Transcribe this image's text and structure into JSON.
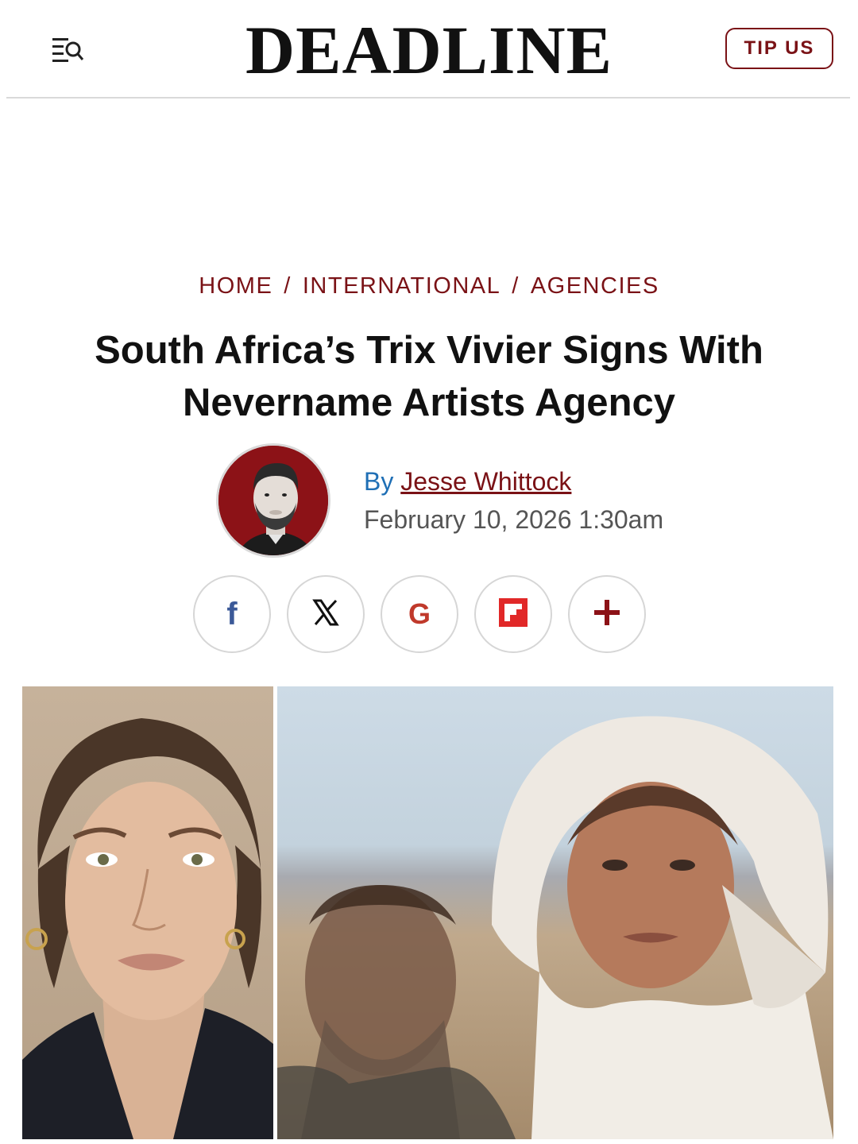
{
  "header": {
    "logo_text": "DEADLINE",
    "tip_label": "TIP US",
    "menu_icon": "menu-search-icon"
  },
  "breadcrumb": {
    "items": [
      {
        "label": "HOME"
      },
      {
        "label": "INTERNATIONAL"
      },
      {
        "label": "AGENCIES"
      }
    ],
    "separator": "/"
  },
  "article": {
    "title_line1": "South Africa’s Trix Vivier Signs With",
    "title_line2": "Nevername Artists Agency",
    "byline_prefix": "By",
    "author": "Jesse Whittock",
    "date": "February 10, 2026 1:30am"
  },
  "share": {
    "buttons": [
      {
        "icon": "facebook-icon",
        "glyph": "f",
        "color": "#3b5998"
      },
      {
        "icon": "x-icon",
        "glyph": "𝕏",
        "color": "#111111"
      },
      {
        "icon": "google-icon",
        "glyph": "G",
        "color": "#c0392b"
      },
      {
        "icon": "flipboard-icon",
        "glyph": "",
        "color": "#e12828"
      },
      {
        "icon": "plus-icon",
        "glyph": "+",
        "color": "#8c1217"
      }
    ]
  },
  "colors": {
    "brand_red": "#7a1216",
    "link_blue": "#1f6fb5",
    "rule_gray": "#d9d9d9"
  }
}
